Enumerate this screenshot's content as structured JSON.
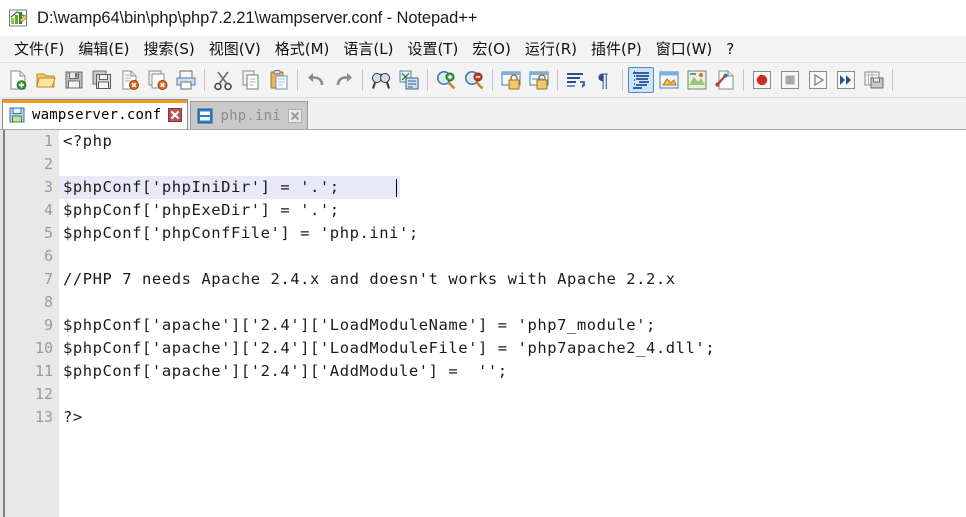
{
  "window": {
    "title": "D:\\wamp64\\bin\\php\\php7.2.21\\wampserver.conf - Notepad++",
    "icon": "notepadpp-icon"
  },
  "menubar": {
    "items": [
      {
        "label": "文件(F)",
        "name": "menu-file"
      },
      {
        "label": "编辑(E)",
        "name": "menu-edit"
      },
      {
        "label": "搜索(S)",
        "name": "menu-search"
      },
      {
        "label": "视图(V)",
        "name": "menu-view"
      },
      {
        "label": "格式(M)",
        "name": "menu-format"
      },
      {
        "label": "语言(L)",
        "name": "menu-language"
      },
      {
        "label": "设置(T)",
        "name": "menu-settings"
      },
      {
        "label": "宏(O)",
        "name": "menu-macro"
      },
      {
        "label": "运行(R)",
        "name": "menu-run"
      },
      {
        "label": "插件(P)",
        "name": "menu-plugins"
      },
      {
        "label": "窗口(W)",
        "name": "menu-window"
      },
      {
        "label": "?",
        "name": "menu-help"
      }
    ]
  },
  "toolbar": {
    "buttons": [
      {
        "name": "new-file-icon",
        "type": "icon"
      },
      {
        "name": "open-file-icon",
        "type": "icon"
      },
      {
        "name": "save-icon",
        "type": "icon"
      },
      {
        "name": "save-all-icon",
        "type": "icon"
      },
      {
        "name": "close-file-icon",
        "type": "icon"
      },
      {
        "name": "close-all-files-icon",
        "type": "icon"
      },
      {
        "name": "print-icon",
        "type": "icon"
      },
      {
        "name": "separator-1",
        "type": "sep"
      },
      {
        "name": "cut-icon",
        "type": "icon"
      },
      {
        "name": "copy-icon",
        "type": "icon"
      },
      {
        "name": "paste-icon",
        "type": "icon"
      },
      {
        "name": "separator-2",
        "type": "sep"
      },
      {
        "name": "undo-icon",
        "type": "icon"
      },
      {
        "name": "redo-icon",
        "type": "icon"
      },
      {
        "name": "separator-3",
        "type": "sep"
      },
      {
        "name": "find-icon",
        "type": "icon"
      },
      {
        "name": "replace-icon",
        "type": "icon"
      },
      {
        "name": "separator-4",
        "type": "sep"
      },
      {
        "name": "zoom-in-icon",
        "type": "icon"
      },
      {
        "name": "zoom-out-icon",
        "type": "icon"
      },
      {
        "name": "separator-5",
        "type": "sep"
      },
      {
        "name": "sync-vertical-scroll-icon",
        "type": "icon"
      },
      {
        "name": "sync-horizontal-scroll-icon",
        "type": "icon"
      },
      {
        "name": "separator-6",
        "type": "sep"
      },
      {
        "name": "word-wrap-icon",
        "type": "icon"
      },
      {
        "name": "show-all-characters-icon",
        "type": "icon"
      },
      {
        "name": "separator-7",
        "type": "sep"
      },
      {
        "name": "indent-guideline-icon",
        "type": "icon",
        "state": "active"
      },
      {
        "name": "user-defined-dialog-icon",
        "type": "icon"
      },
      {
        "name": "document-map-icon",
        "type": "icon"
      },
      {
        "name": "function-list-icon",
        "type": "icon"
      },
      {
        "name": "separator-8",
        "type": "sep"
      },
      {
        "name": "record-macro-icon",
        "type": "icon"
      },
      {
        "name": "stop-recording-macro-icon",
        "type": "icon"
      },
      {
        "name": "play-macro-icon",
        "type": "icon"
      },
      {
        "name": "run-macro-multiple-times-icon",
        "type": "icon"
      },
      {
        "name": "save-macro-icon",
        "type": "icon"
      },
      {
        "name": "separator-9",
        "type": "sep"
      }
    ]
  },
  "tabs": [
    {
      "label": "wampserver.conf",
      "active": true,
      "icon": "saved-file-icon",
      "close": "close-icon-red"
    },
    {
      "label": "php.ini",
      "active": false,
      "icon": "file-icon-blue",
      "close": "close-icon-white"
    }
  ],
  "editor": {
    "current_line": 3,
    "lines": [
      {
        "num": "1",
        "text": "<?php"
      },
      {
        "num": "2",
        "text": ""
      },
      {
        "num": "3",
        "text": "$phpConf['phpIniDir'] = '.';"
      },
      {
        "num": "4",
        "text": "$phpConf['phpExeDir'] = '.';"
      },
      {
        "num": "5",
        "text": "$phpConf['phpConfFile'] = 'php.ini';"
      },
      {
        "num": "6",
        "text": ""
      },
      {
        "num": "7",
        "text": "//PHP 7 needs Apache 2.4.x and doesn't works with Apache 2.2.x"
      },
      {
        "num": "8",
        "text": ""
      },
      {
        "num": "9",
        "text": "$phpConf['apache']['2.4']['LoadModuleName'] = 'php7_module';"
      },
      {
        "num": "10",
        "text": "$phpConf['apache']['2.4']['LoadModuleFile'] = 'php7apache2_4.dll';"
      },
      {
        "num": "11",
        "text": "$phpConf['apache']['2.4']['AddModule'] =  '';"
      },
      {
        "num": "12",
        "text": ""
      },
      {
        "num": "13",
        "text": "?>"
      }
    ]
  },
  "colors": {
    "accent_orange": "#f29a21",
    "gutter_bg": "#e8e8e8",
    "line_number": "#9a9a9a",
    "current_line_highlight": "#e8e8f7",
    "toolbar_bg": "#f3f3f3",
    "inactive_tab_bg": "#c9c9c9",
    "code_text": "#1b1b1b"
  }
}
